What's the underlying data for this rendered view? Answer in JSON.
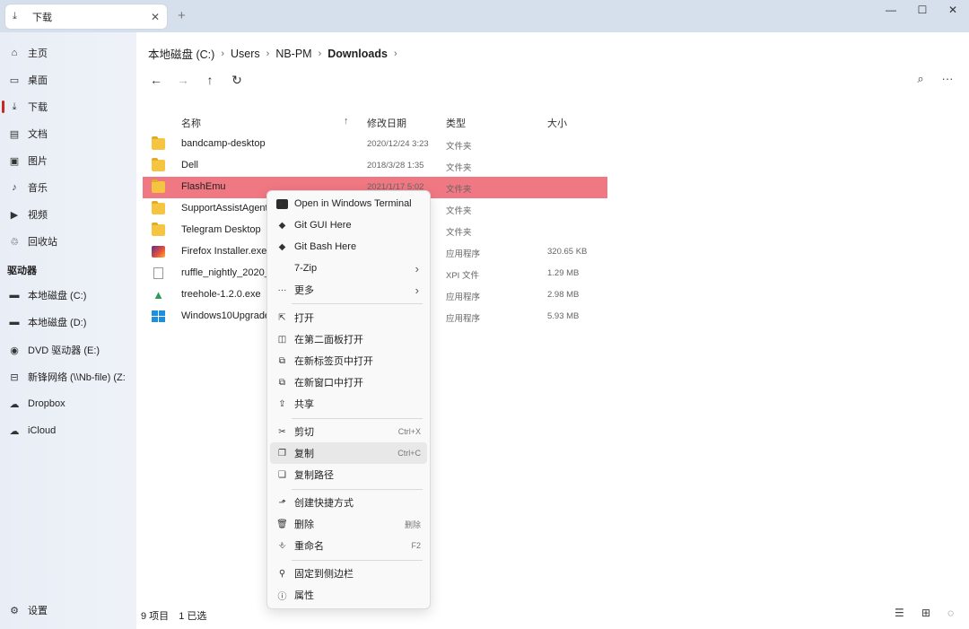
{
  "window": {
    "tab_title": "下载",
    "tab_close": "✕",
    "new_tab": "+",
    "minimize": "—",
    "maximize": "☐",
    "close": "✕"
  },
  "sidebar": {
    "items": [
      {
        "label": "主页",
        "icon": "home-icon"
      },
      {
        "label": "桌面",
        "icon": "desktop-icon"
      },
      {
        "label": "下载",
        "icon": "download-icon"
      },
      {
        "label": "文档",
        "icon": "document-icon"
      },
      {
        "label": "图片",
        "icon": "picture-icon"
      },
      {
        "label": "音乐",
        "icon": "music-icon"
      },
      {
        "label": "视频",
        "icon": "video-icon"
      },
      {
        "label": "回收站",
        "icon": "recycle-bin-icon"
      }
    ],
    "drives_label": "驱动器",
    "drives": [
      {
        "label": "本地磁盘 (C:)",
        "icon": "drive-icon"
      },
      {
        "label": "本地磁盘 (D:)",
        "icon": "drive-icon"
      },
      {
        "label": "DVD 驱动器 (E:)",
        "icon": "dvd-icon"
      },
      {
        "label": "新锋网络 (\\\\Nb-file) (Z:",
        "icon": "network-drive-icon"
      },
      {
        "label": "Dropbox",
        "icon": "cloud-icon"
      },
      {
        "label": "iCloud",
        "icon": "cloud-icon"
      }
    ],
    "settings_label": "设置"
  },
  "breadcrumb": {
    "items": [
      "本地磁盘 (C:)",
      "Users",
      "NB-PM",
      "Downloads"
    ],
    "sep": "›"
  },
  "toolbar": {
    "back": "←",
    "forward": "→",
    "up": "↑",
    "refresh": "↻",
    "search": "⌕",
    "more": "···"
  },
  "columns": {
    "name": "名称",
    "sort_arrow": "↑",
    "date": "修改日期",
    "type": "类型",
    "size": "大小"
  },
  "files": [
    {
      "name": "bandcamp-desktop",
      "date": "2020/12/24 3:23",
      "type": "文件夹",
      "size": "",
      "kind": "folder"
    },
    {
      "name": "Dell",
      "date": "2018/3/28 1:35",
      "type": "文件夹",
      "size": "",
      "kind": "folder"
    },
    {
      "name": "FlashEmu",
      "date": "2021/1/17 5:02",
      "type": "文件夹",
      "size": "",
      "kind": "folder"
    },
    {
      "name": "SupportAssistAgent",
      "date": "",
      "type": "文件夹",
      "size": "",
      "kind": "folder"
    },
    {
      "name": "Telegram Desktop",
      "date": "",
      "type": "文件夹",
      "size": "",
      "kind": "folder"
    },
    {
      "name": "Firefox Installer.exe",
      "date": "",
      "type": "应用程序",
      "size": "320.65 KB",
      "kind": "firefox"
    },
    {
      "name": "ruffle_nightly_2020_1",
      "date": "",
      "type": "XPI 文件",
      "size": "1.29 MB",
      "kind": "file"
    },
    {
      "name": "treehole-1.2.0.exe",
      "date": "",
      "type": "应用程序",
      "size": "2.98 MB",
      "kind": "tree"
    },
    {
      "name": "Windows10Upgrade",
      "date": "",
      "type": "应用程序",
      "size": "5.93 MB",
      "kind": "windows"
    }
  ],
  "status": {
    "count": "9 项目",
    "selected": "1 已选"
  },
  "context_menu": {
    "items": [
      {
        "label": "Open in Windows Terminal",
        "icon": "terminal-icon",
        "shortcut": "",
        "arrow": ""
      },
      {
        "label": "Git GUI Here",
        "icon": "git-icon",
        "shortcut": "",
        "arrow": ""
      },
      {
        "label": "Git Bash Here",
        "icon": "git-icon",
        "shortcut": "",
        "arrow": ""
      },
      {
        "label": "7-Zip",
        "icon": "",
        "shortcut": "",
        "arrow": "›"
      },
      {
        "label": "更多",
        "icon": "ellipsis-icon",
        "shortcut": "",
        "arrow": "›"
      },
      {
        "label": "打开",
        "icon": "open-icon",
        "shortcut": "",
        "arrow": ""
      },
      {
        "label": "在第二面板打开",
        "icon": "dual-pane-icon",
        "shortcut": "",
        "arrow": ""
      },
      {
        "label": "在新标签页中打开",
        "icon": "new-tab-icon",
        "shortcut": "",
        "arrow": ""
      },
      {
        "label": "在新窗口中打开",
        "icon": "new-window-icon",
        "shortcut": "",
        "arrow": ""
      },
      {
        "label": "共享",
        "icon": "share-icon",
        "shortcut": "",
        "arrow": ""
      },
      {
        "label": "剪切",
        "icon": "cut-icon",
        "shortcut": "Ctrl+X",
        "arrow": ""
      },
      {
        "label": "复制",
        "icon": "copy-icon",
        "shortcut": "Ctrl+C",
        "arrow": ""
      },
      {
        "label": "复制路径",
        "icon": "copy-path-icon",
        "shortcut": "",
        "arrow": ""
      },
      {
        "label": "创建快捷方式",
        "icon": "shortcut-icon",
        "shortcut": "",
        "arrow": ""
      },
      {
        "label": "删除",
        "icon": "delete-icon",
        "shortcut": "删除",
        "arrow": ""
      },
      {
        "label": "重命名",
        "icon": "rename-icon",
        "shortcut": "F2",
        "arrow": ""
      },
      {
        "label": "固定到侧边栏",
        "icon": "pin-icon",
        "shortcut": "",
        "arrow": ""
      },
      {
        "label": "属性",
        "icon": "info-icon",
        "shortcut": "",
        "arrow": ""
      }
    ]
  },
  "colors": {
    "selection": "#f07883",
    "accent": "#c42b1c",
    "titlebar": "#d6e0ec"
  }
}
